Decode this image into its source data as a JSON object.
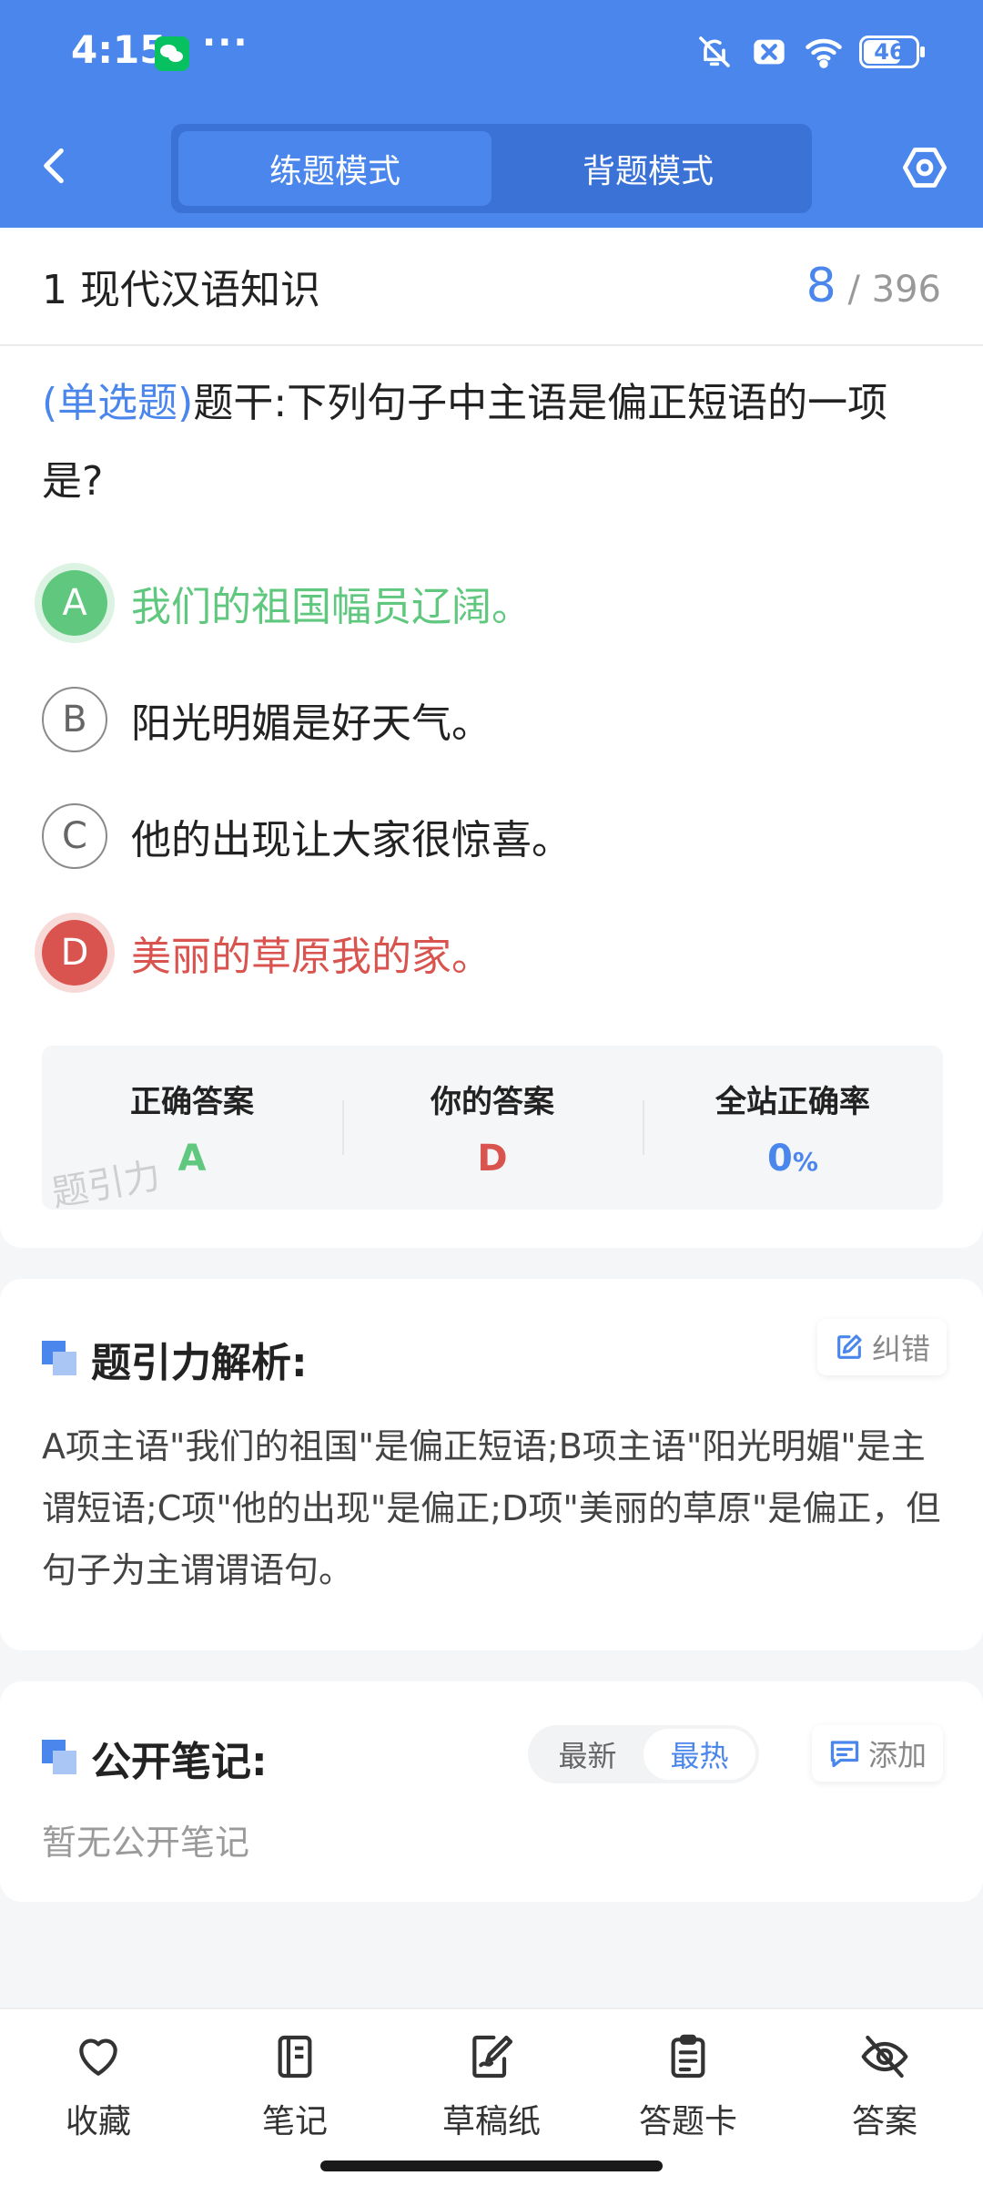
{
  "status": {
    "time": "4:15",
    "dots": "···",
    "battery": "46"
  },
  "header": {
    "tabs": [
      {
        "label": "练题模式",
        "active": true
      },
      {
        "label": "背题模式",
        "active": false
      }
    ]
  },
  "question": {
    "section": "1 现代汉语知识",
    "current": "8",
    "total": "/ 396",
    "type": "(单选题)",
    "stem": "题干:下列句子中主语是偏正短语的一项是?",
    "options": [
      {
        "letter": "A",
        "text": "我们的祖国幅员辽阔。",
        "state": "correct"
      },
      {
        "letter": "B",
        "text": "阳光明媚是好天气。",
        "state": "normal"
      },
      {
        "letter": "C",
        "text": "他的出现让大家很惊喜。",
        "state": "normal"
      },
      {
        "letter": "D",
        "text": "美丽的草原我的家。",
        "state": "wrong"
      }
    ]
  },
  "stats": {
    "correct_label": "正确答案",
    "correct_value": "A",
    "yours_label": "你的答案",
    "yours_value": "D",
    "rate_label": "全站正确率",
    "rate_value": "0",
    "rate_unit": "%",
    "watermark": "题引力"
  },
  "analysis": {
    "title": "题引力解析:",
    "report_label": "纠错",
    "text": "A项主语\"我们的祖国\"是偏正短语;B项主语\"阳光明媚\"是主谓短语;C项\"他的出现\"是偏正;D项\"美丽的草原\"是偏正，但句子为主谓谓语句。"
  },
  "notes": {
    "title": "公开笔记:",
    "sort_latest": "最新",
    "sort_hot": "最热",
    "add_label": "添加",
    "empty": "暂无公开笔记"
  },
  "tabbar": {
    "items": [
      {
        "label": "收藏",
        "icon": "heart-icon"
      },
      {
        "label": "笔记",
        "icon": "notebook-icon"
      },
      {
        "label": "草稿纸",
        "icon": "draft-icon"
      },
      {
        "label": "答题卡",
        "icon": "answer-sheet-icon"
      },
      {
        "label": "答案",
        "icon": "eye-off-icon"
      }
    ]
  },
  "colors": {
    "primary": "#4a86ec",
    "correct": "#5fc87e",
    "wrong": "#d9534f"
  }
}
